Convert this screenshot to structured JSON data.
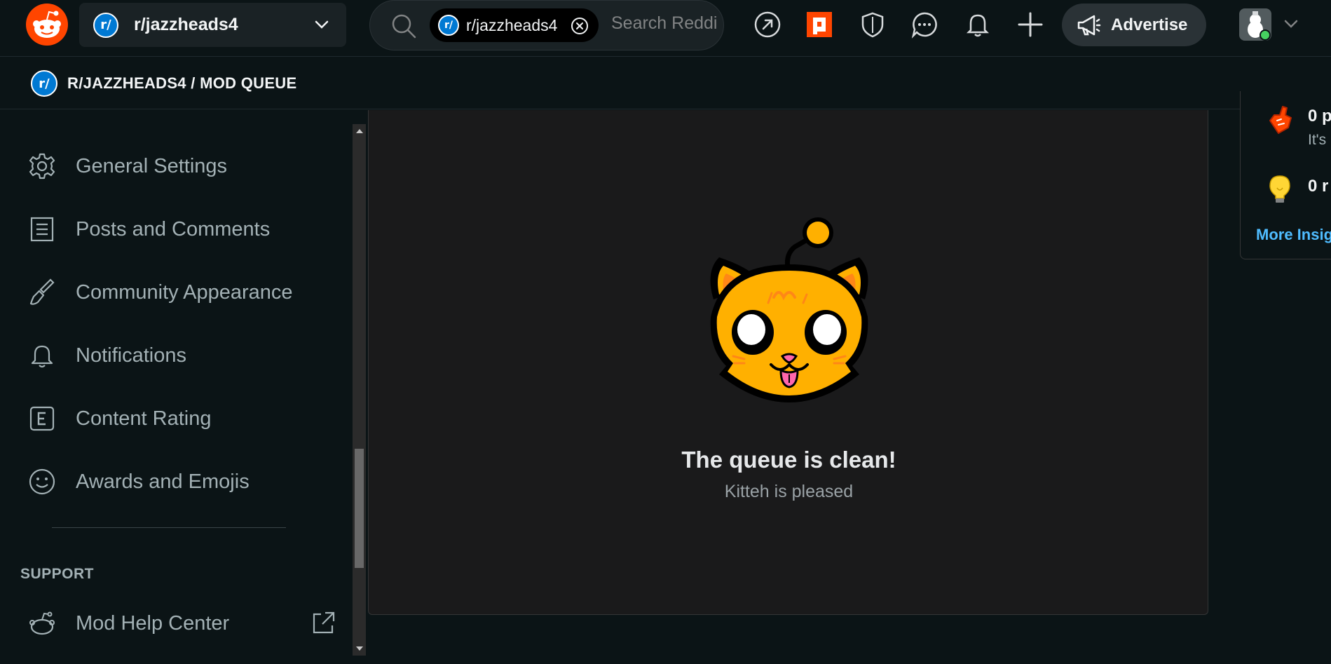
{
  "header": {
    "community_name": "r/jazzheads4",
    "search": {
      "chip_label": "r/jazzheads4",
      "placeholder": "Search Reddit"
    },
    "advertise_label": "Advertise"
  },
  "breadcrumb": {
    "text": "R/JAZZHEADS4 / MOD QUEUE"
  },
  "sidebar": {
    "items": [
      {
        "label": "General Settings",
        "icon": "gear-icon"
      },
      {
        "label": "Posts and Comments",
        "icon": "document-icon"
      },
      {
        "label": "Community Appearance",
        "icon": "brush-icon"
      },
      {
        "label": "Notifications",
        "icon": "bell-icon"
      },
      {
        "label": "Content Rating",
        "icon": "rating-e-icon"
      },
      {
        "label": "Awards and Emojis",
        "icon": "smiley-icon"
      }
    ],
    "support_heading": "SUPPORT",
    "support_items": [
      {
        "label": "Mod Help Center",
        "icon": "snoo-icon"
      }
    ]
  },
  "queue": {
    "title": "The queue is clean!",
    "subtitle": "Kitteh is pleased"
  },
  "insights": {
    "stat1_value": "0 p",
    "stat1_sub": "It's",
    "stat2_value": "0 r",
    "more_link": "More Insig"
  },
  "colors": {
    "background": "#0b1416",
    "panel": "#1a1a1b",
    "reddit_orange": "#ff4500",
    "link_blue": "#4fbcff",
    "kitteh_orange": "#ffb000"
  }
}
